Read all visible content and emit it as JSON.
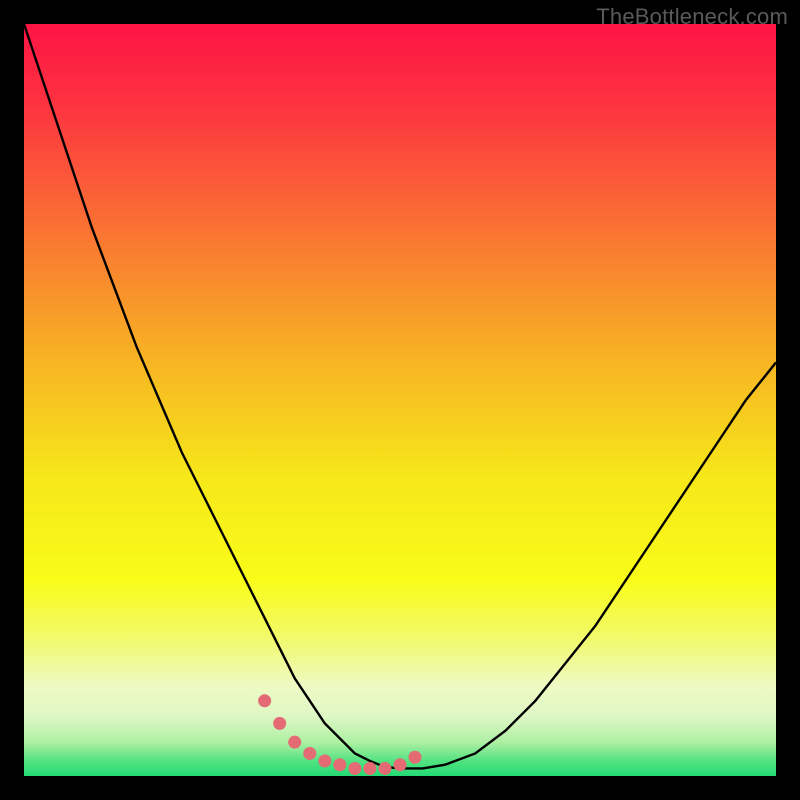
{
  "watermark": "TheBottleneck.com",
  "colors": {
    "frame": "#000000",
    "curve": "#000000",
    "marker": "#e46a74",
    "gradient_stops": [
      {
        "offset": 0.0,
        "color": "#fd1444"
      },
      {
        "offset": 0.1,
        "color": "#fd3040"
      },
      {
        "offset": 0.25,
        "color": "#fa6a35"
      },
      {
        "offset": 0.45,
        "color": "#f7b523"
      },
      {
        "offset": 0.6,
        "color": "#f6e719"
      },
      {
        "offset": 0.74,
        "color": "#f9fc19"
      },
      {
        "offset": 0.82,
        "color": "#f1fa6f"
      },
      {
        "offset": 0.88,
        "color": "#eefac4"
      },
      {
        "offset": 0.92,
        "color": "#dff8c5"
      },
      {
        "offset": 0.955,
        "color": "#aef0a3"
      },
      {
        "offset": 0.98,
        "color": "#53e281"
      },
      {
        "offset": 1.0,
        "color": "#22db74"
      }
    ]
  },
  "chart_data": {
    "type": "line",
    "title": "",
    "xlabel": "",
    "ylabel": "",
    "xlim": [
      0,
      100
    ],
    "ylim": [
      0,
      100
    ],
    "grid": false,
    "x": [
      0,
      3,
      6,
      9,
      12,
      15,
      18,
      21,
      24,
      27,
      30,
      32,
      34,
      36,
      38,
      40,
      42,
      44,
      46,
      48,
      50,
      53,
      56,
      60,
      64,
      68,
      72,
      76,
      80,
      84,
      88,
      92,
      96,
      100
    ],
    "values": [
      100,
      91,
      82,
      73,
      65,
      57,
      50,
      43,
      37,
      31,
      25,
      21,
      17,
      13,
      10,
      7,
      5,
      3,
      2,
      1.2,
      1,
      1,
      1.5,
      3,
      6,
      10,
      15,
      20,
      26,
      32,
      38,
      44,
      50,
      55
    ],
    "markers": {
      "x": [
        32,
        34,
        36,
        38,
        40,
        42,
        44,
        46,
        48,
        50,
        52
      ],
      "y": [
        10,
        7,
        4.5,
        3,
        2,
        1.5,
        1,
        1,
        1,
        1.5,
        2.5
      ]
    },
    "annotations": [
      {
        "text": "TheBottleneck.com",
        "position": "top-right"
      }
    ]
  }
}
